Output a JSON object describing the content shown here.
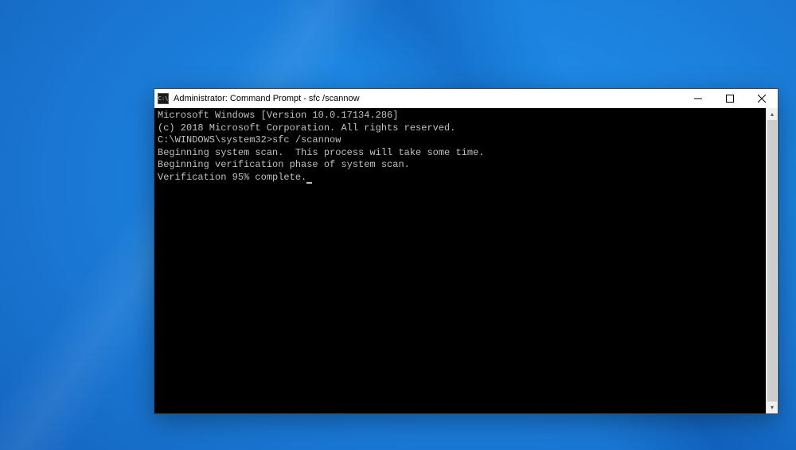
{
  "window": {
    "title": "Administrator: Command Prompt - sfc  /scannow",
    "icon_glyph": "C:\\"
  },
  "terminal": {
    "lines": [
      "Microsoft Windows [Version 10.0.17134.286]",
      "(c) 2018 Microsoft Corporation. All rights reserved.",
      "",
      "C:\\WINDOWS\\system32>sfc /scannow",
      "",
      "Beginning system scan.  This process will take some time.",
      "",
      "Beginning verification phase of system scan.",
      "Verification 95% complete."
    ],
    "prompt_path": "C:\\WINDOWS\\system32>",
    "command": "sfc /scannow",
    "progress_percent": 95
  },
  "controls": {
    "minimize_tooltip": "Minimize",
    "maximize_tooltip": "Maximize",
    "close_tooltip": "Close"
  }
}
